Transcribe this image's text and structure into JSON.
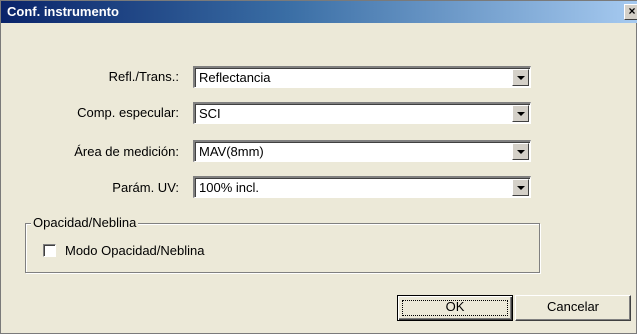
{
  "window": {
    "title": "Conf. instrumento",
    "close_glyph": "×"
  },
  "fields": {
    "refl_trans": {
      "label": "Refl./Trans.:",
      "value": "Reflectancia"
    },
    "comp_especular": {
      "label": "Comp. especular:",
      "value": "SCI"
    },
    "area_medicion": {
      "label": "Área de medición:",
      "value": "MAV(8mm)"
    },
    "param_uv": {
      "label": "Parám. UV:",
      "value": "100% incl."
    }
  },
  "group": {
    "legend": "Opacidad/Neblina",
    "checkbox_label": "Modo Opacidad/Neblina",
    "checked": false
  },
  "buttons": {
    "ok_label": "OK",
    "cancel_label": "Cancelar"
  },
  "colors": {
    "title_bar_start": "#0a246a",
    "title_bar_end": "#a6caf0",
    "dialog_bg": "#ece9d8"
  }
}
